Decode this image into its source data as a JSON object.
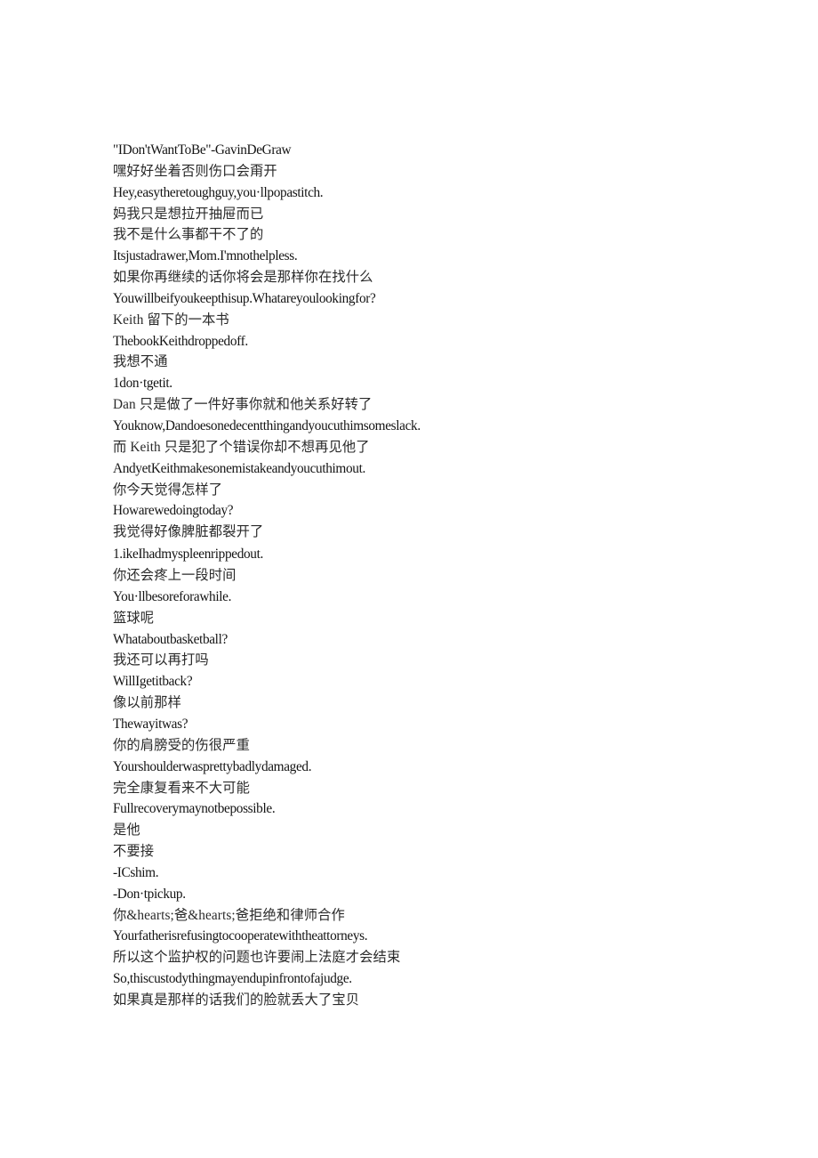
{
  "document": {
    "background_color": "#ffffff",
    "text_color": "#1b1b1b",
    "alignment": "left",
    "lines": [
      {
        "id": "l1",
        "script": "lat",
        "text": "\"IDon'tWantToBe\"-GavinDeGraw"
      },
      {
        "id": "l2",
        "script": "han",
        "text": "嘿好好坐着否则伤口会甭开"
      },
      {
        "id": "l3",
        "script": "lat",
        "text": "Hey,easytheretoughguy,you·llpopastitch."
      },
      {
        "id": "l4",
        "script": "han",
        "text": "妈我只是想拉开抽屉而已"
      },
      {
        "id": "l5",
        "script": "han",
        "text": "我不是什么事都干不了的"
      },
      {
        "id": "l6",
        "script": "lat",
        "text": "Itsjustadrawer,Mom.I'mnothelpless."
      },
      {
        "id": "l7",
        "script": "han",
        "text": "如果你再继续的话你将会是那样你在找什么"
      },
      {
        "id": "l8",
        "script": "lat",
        "text": "Youwillbeifyoukeepthisup.Whatareyoulookingfor?"
      },
      {
        "id": "l9",
        "script": "mix",
        "text": "Keith 留下的一本书"
      },
      {
        "id": "l10",
        "script": "lat",
        "text": "ThebookKeithdroppedoff."
      },
      {
        "id": "l11",
        "script": "han",
        "text": "我想不通"
      },
      {
        "id": "l12",
        "script": "lat",
        "text": "1don·tgetit."
      },
      {
        "id": "l13",
        "script": "mix",
        "text": "Dan 只是做了一件好事你就和他关系好转了"
      },
      {
        "id": "l14",
        "script": "lat",
        "text": "Youknow,Dandoesonedecentthingandyoucuthimsomeslack."
      },
      {
        "id": "l15",
        "script": "mix",
        "text": "而 Keith 只是犯了个错误你却不想再见他了"
      },
      {
        "id": "l16",
        "script": "lat",
        "text": "AndyetKeithmakesonemistakeandyoucuthimout."
      },
      {
        "id": "l17",
        "script": "han",
        "text": "你今天觉得怎样了"
      },
      {
        "id": "l18",
        "script": "lat",
        "text": "Howarewedoingtoday?"
      },
      {
        "id": "l19",
        "script": "han",
        "text": "我觉得好像脾脏都裂开了"
      },
      {
        "id": "l20",
        "script": "lat",
        "text": "1.ikeIhadmyspleenrippedout.",
        "gap_above": true
      },
      {
        "id": "l21",
        "script": "han",
        "text": "你还会疼上一段时间"
      },
      {
        "id": "l22",
        "script": "lat",
        "text": "You·llbesoreforawhile."
      },
      {
        "id": "l23",
        "script": "han",
        "text": "篮球呢"
      },
      {
        "id": "l24",
        "script": "lat",
        "text": "Whataboutbasketball?"
      },
      {
        "id": "l25",
        "script": "han",
        "text": "我还可以再打吗"
      },
      {
        "id": "l26",
        "script": "lat",
        "text": "WillIgetitback?"
      },
      {
        "id": "l27",
        "script": "han",
        "text": "像以前那样"
      },
      {
        "id": "l28",
        "script": "lat",
        "text": "Thewayitwas?"
      },
      {
        "id": "l29",
        "script": "han",
        "text": "你的肩膀受的伤很严重"
      },
      {
        "id": "l30",
        "script": "lat",
        "text": "Yourshoulderwasprettybadlydamaged."
      },
      {
        "id": "l31",
        "script": "han",
        "text": "完全康复看来不大可能"
      },
      {
        "id": "l32",
        "script": "lat",
        "text": "Fullrecoverymaynotbepossible."
      },
      {
        "id": "l33",
        "script": "han",
        "text": "是他"
      },
      {
        "id": "l34",
        "script": "han",
        "text": "不要接"
      },
      {
        "id": "l35",
        "script": "lat",
        "text": "-ICshim."
      },
      {
        "id": "l36",
        "script": "lat",
        "text": "-Don·tpickup."
      },
      {
        "id": "l37",
        "script": "mix",
        "text": "你&hearts;爸&hearts;爸拒绝和律师合作"
      },
      {
        "id": "l38",
        "script": "lat",
        "text": "Yourfatherisrefusingtocooperatewiththeattorneys."
      },
      {
        "id": "l39",
        "script": "han",
        "text": "所以这个监护权的问题也许要闹上法庭才会结束"
      },
      {
        "id": "l40",
        "script": "lat",
        "text": "So,thiscustodythingmayendupinfrontofajudge."
      },
      {
        "id": "l41",
        "script": "han",
        "text": "如果真是那样的话我们的脸就丢大了宝贝"
      }
    ]
  }
}
